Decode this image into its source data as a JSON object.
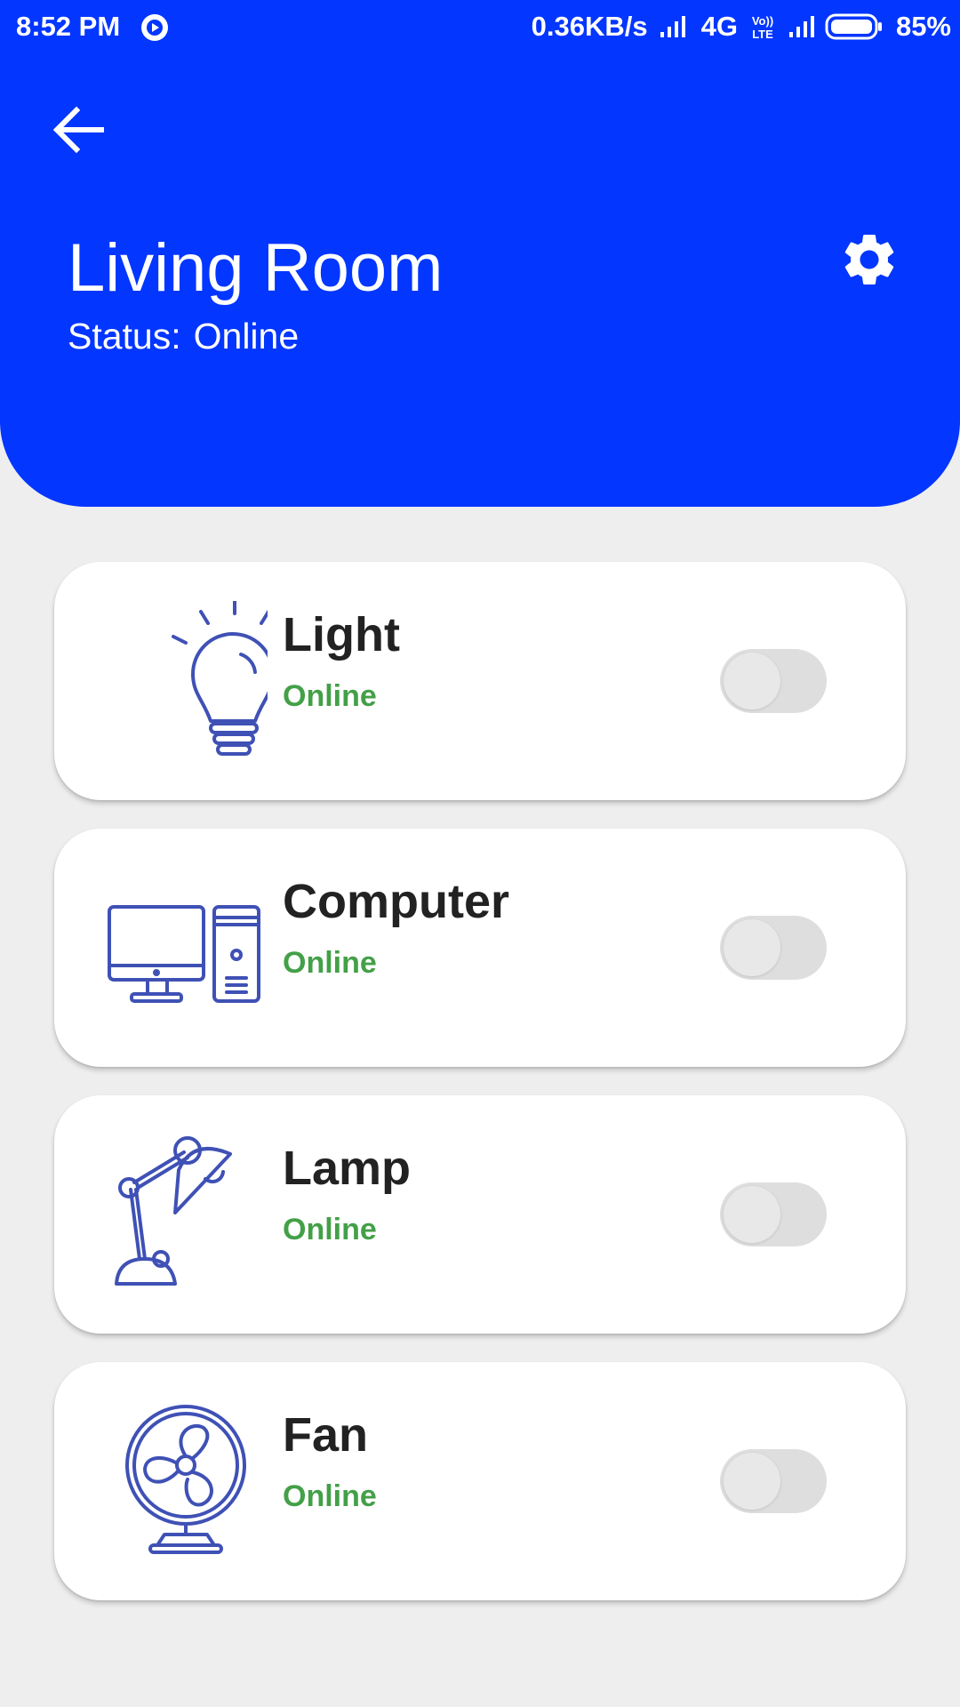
{
  "status_bar": {
    "time": "8:52 PM",
    "net_speed": "0.36KB/s",
    "network": "4G",
    "volte": "Vo)) LTE",
    "battery": "85%"
  },
  "header": {
    "title": "Living Room",
    "status_label": "Status:",
    "status_value": "Online",
    "back_icon": "arrow-left-icon",
    "settings_icon": "gear-icon"
  },
  "colors": {
    "header_bg": "#0336ff",
    "icon_color": "#3f51b5",
    "online_color": "#43a047",
    "page_bg": "#eeeeee"
  },
  "devices": [
    {
      "name": "Light",
      "status": "Online",
      "icon": "lightbulb-icon",
      "on": false
    },
    {
      "name": "Computer",
      "status": "Online",
      "icon": "computer-icon",
      "on": false
    },
    {
      "name": "Lamp",
      "status": "Online",
      "icon": "desk-lamp-icon",
      "on": false
    },
    {
      "name": "Fan",
      "status": "Online",
      "icon": "fan-icon",
      "on": false
    }
  ]
}
